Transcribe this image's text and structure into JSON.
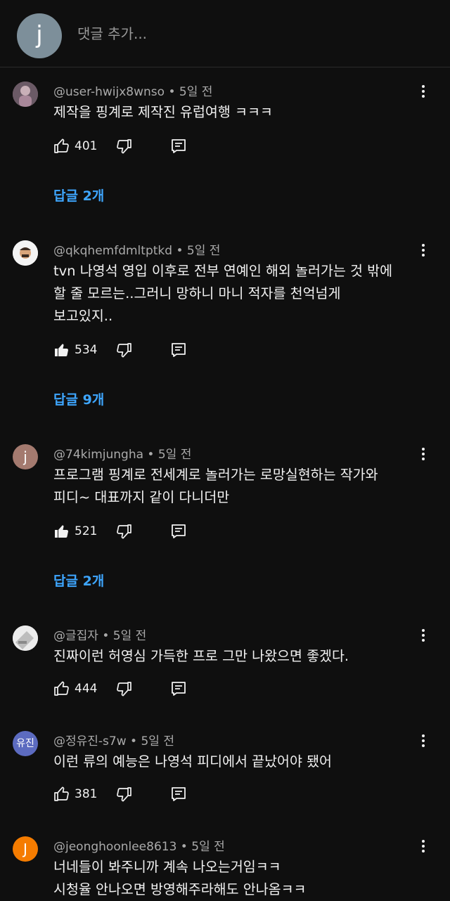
{
  "add_comment": {
    "avatar_letter": "j",
    "placeholder": "댓글 추가..."
  },
  "comments": [
    {
      "author": "@user-hwijx8wnso",
      "time": "5일 전",
      "lines": [
        "제작을 핑계로 제작진 유럽여행 ㅋㅋㅋ"
      ],
      "likes": "401",
      "liked": false,
      "replies": "답글 2개"
    },
    {
      "author": "@qkqhemfdmltptkd",
      "time": "5일 전",
      "lines": [
        "tvn 나영석 영입 이후로 전부 연예인 해외 놀러가는 것 밖에",
        "할 줄 모르는..그러니 망하니 마니 적자를 천억넘게",
        "보고있지.."
      ],
      "likes": "534",
      "liked": true,
      "replies": "답글 9개"
    },
    {
      "author": "@74kimjungha",
      "time": "5일 전",
      "avatar_letter": "j",
      "lines": [
        "프로그램 핑계로 전세계로 놀러가는 로망실현하는 작가와",
        "피디~ 대표까지 같이 다니더만"
      ],
      "likes": "521",
      "liked": true,
      "replies": "답글 2개"
    },
    {
      "author": "@글집자",
      "time": "5일 전",
      "lines": [
        "진짜이런 허영심 가득한 프로 그만 나왔으면 좋겠다."
      ],
      "likes": "444",
      "liked": false
    },
    {
      "author": "@정유진-s7w",
      "time": "5일 전",
      "avatar_letter": "유진",
      "lines": [
        "이런 류의 예능은 나영석 피디에서 끝났어야 됐어"
      ],
      "likes": "381",
      "liked": false
    },
    {
      "author": "@jeonghoonlee8613",
      "time": "5일 전",
      "avatar_letter": "J",
      "lines": [
        "너네들이 봐주니까 계속 나오는거임ㅋㅋ",
        "시청율 안나오면 방영해주라해도 안나옴ㅋㅋ"
      ]
    }
  ],
  "colors": {
    "background": "#0f0f0f",
    "link": "#3ea6ff",
    "secondary_text": "#aaaaaa"
  }
}
